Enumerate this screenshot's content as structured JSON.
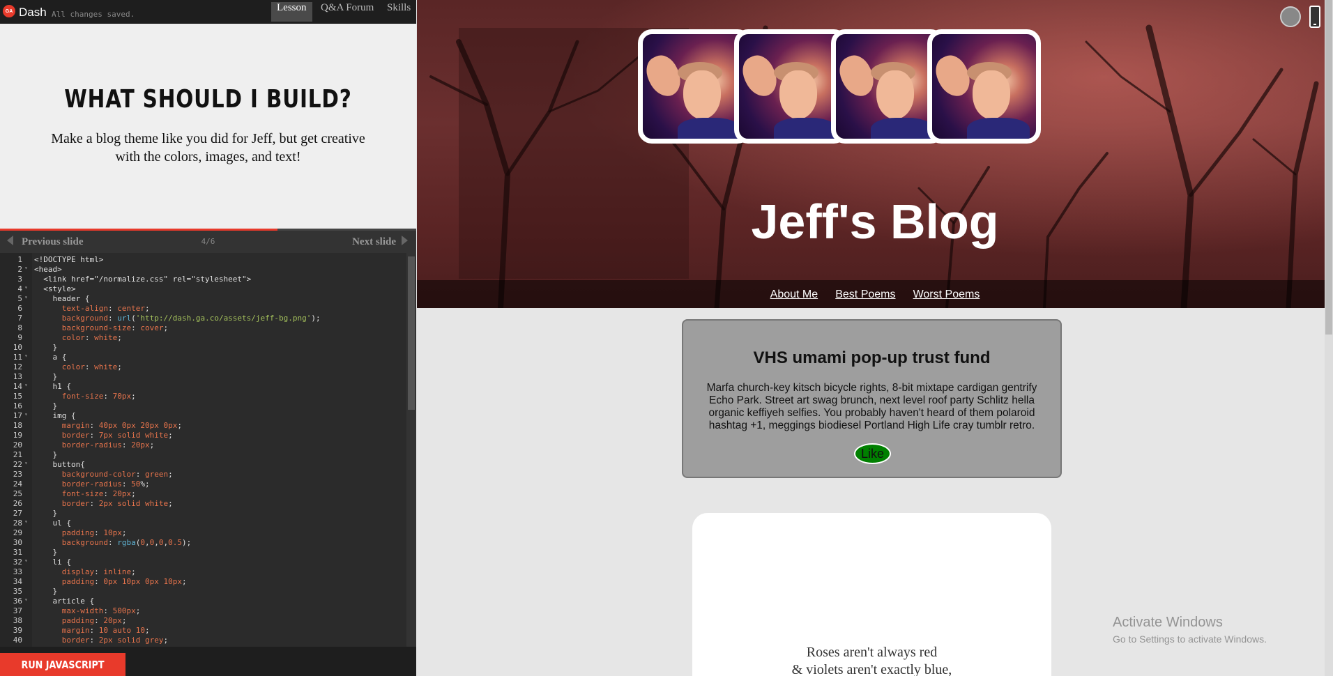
{
  "app": {
    "brand_logo": "GA",
    "brand_name": "Dash",
    "save_status": "All changes saved.",
    "nav": [
      {
        "label": "Lesson",
        "active": true
      },
      {
        "label": "Q&A Forum",
        "active": false
      },
      {
        "label": "Skills",
        "active": false
      }
    ]
  },
  "lesson": {
    "title": "WHAT SHOULD I BUILD?",
    "body": "Make a blog theme like you did for Jeff, but get creative with the colors, images, and text!",
    "progress_fraction": 0.667,
    "prev_label": "Previous slide",
    "next_label": "Next slide",
    "slide_counter": "4/6"
  },
  "editor": {
    "lines": [
      "<!DOCTYPE html>",
      "<head>",
      "  <link href=\"/normalize.css\" rel=\"stylesheet\">",
      "  <style>",
      "    header {",
      "      text-align: center;",
      "      background: url('http://dash.ga.co/assets/jeff-bg.png');",
      "      background-size: cover;",
      "      color: white;",
      "    }",
      "    a {",
      "      color: white;",
      "    }",
      "    h1 {",
      "      font-size: 70px;",
      "    }",
      "    img {",
      "      margin: 40px 0px 20px 0px;",
      "      border: 7px solid white;",
      "      border-radius: 20px;",
      "    }",
      "    button{",
      "      background-color: green;",
      "      border-radius: 50%;",
      "      font-size: 20px;",
      "      border: 2px solid white;",
      "    }",
      "    ul {",
      "      padding: 10px;",
      "      background: rgba(0,0,0,0.5);",
      "    }",
      "    li {",
      "      display: inline;",
      "      padding: 0px 10px 0px 10px;",
      "    }",
      "    article {",
      "      max-width: 500px;",
      "      padding: 20px;",
      "      margin: 10 auto 10;",
      "      border: 2px solid grey;"
    ],
    "fold_lines": [
      2,
      4,
      5,
      11,
      14,
      17,
      22,
      28,
      32,
      36
    ]
  },
  "run_button": "RUN JAVASCRIPT",
  "preview": {
    "blog_title": "Jeff's Blog",
    "nav_links": [
      "About Me",
      "Best Poems",
      "Worst Poems"
    ],
    "article_title": "VHS umami pop-up trust fund",
    "article_body": "Marfa church-key kitsch bicycle rights, 8-bit mixtape cardigan gentrify Echo Park. Street art swag brunch, next level roof party Schlitz hella organic keffiyeh selfies. You probably haven't heard of them polaroid hashtag +1, meggings biodiesel Portland High Life cray tumblr retro.",
    "like_label": "Like",
    "like_color": "#008000",
    "poem_line1": "Roses aren't always red",
    "poem_line2": "& violets aren't exactly blue,"
  },
  "watermark": {
    "title": "Activate Windows",
    "subtitle": "Go to Settings to activate Windows."
  },
  "colors": {
    "accent": "#e83a2b",
    "editor_bg": "#2b2b2b",
    "header_tint": "#6b2f2f"
  },
  "icons": [
    "ga-logo-icon",
    "arrow-left-icon",
    "arrow-right-icon",
    "circle-toggle-icon",
    "phone-icon"
  ]
}
